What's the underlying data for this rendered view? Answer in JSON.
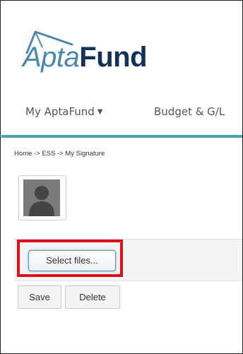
{
  "logo": {
    "part1": "Apta",
    "part2": "Fund"
  },
  "nav": {
    "items": [
      {
        "label": "My AptaFund",
        "has_dropdown": true
      },
      {
        "label": "Budget & G/L"
      }
    ],
    "caret": "▼"
  },
  "breadcrumb": "Home -> ESS -> My Signature",
  "avatar": {
    "icon": "user-silhouette-icon"
  },
  "upload": {
    "select_files_label": "Select files..."
  },
  "actions": {
    "save_label": "Save",
    "delete_label": "Delete"
  },
  "colors": {
    "accent_rule": "#49a3b2",
    "logo_light": "#4a88b4",
    "logo_dark": "#13325a",
    "highlight": "#d9141f"
  }
}
